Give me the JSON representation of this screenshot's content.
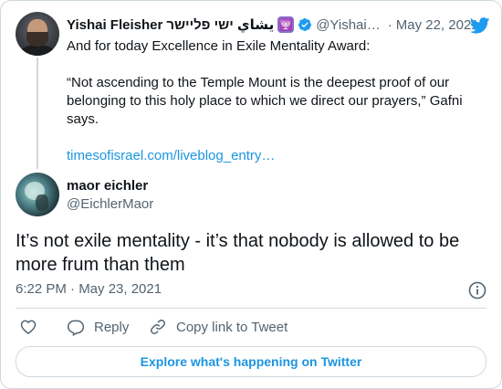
{
  "parent_tweet": {
    "display_name": "Yishai Fleisher",
    "display_name_rtl": "يشاي ישי פליישר",
    "handle": "@Yishai…",
    "separator": "·",
    "date": "May 22, 2021",
    "line1": "And for today Excellence in Exile Mentality Award:",
    "line2": "“Not ascending to the Temple Mount is the deepest proof of our belonging to this holy place to which we direct our prayers,” Gafni says.",
    "link": "timesofisrael.com/liveblog_entry…",
    "icons": [
      "menorah-icon",
      "verified-icon",
      "twitter-bird-icon"
    ]
  },
  "tweet": {
    "display_name": "maor eichler",
    "handle": "@EichlerMaor",
    "text": "It’s not exile mentality - it’s that nobody is allowed to be more frum than them",
    "timestamp": "6:22 PM · May 23, 2021"
  },
  "actions": {
    "reply_label": "Reply",
    "copy_label": "Copy link to Tweet"
  },
  "footer": {
    "explore_label": "Explore what's happening on Twitter"
  },
  "colors": {
    "accent": "#1b95e0",
    "text": "#0f1419",
    "muted": "#536471",
    "border": "#cfd9de",
    "verified": "#1d9bf0"
  }
}
